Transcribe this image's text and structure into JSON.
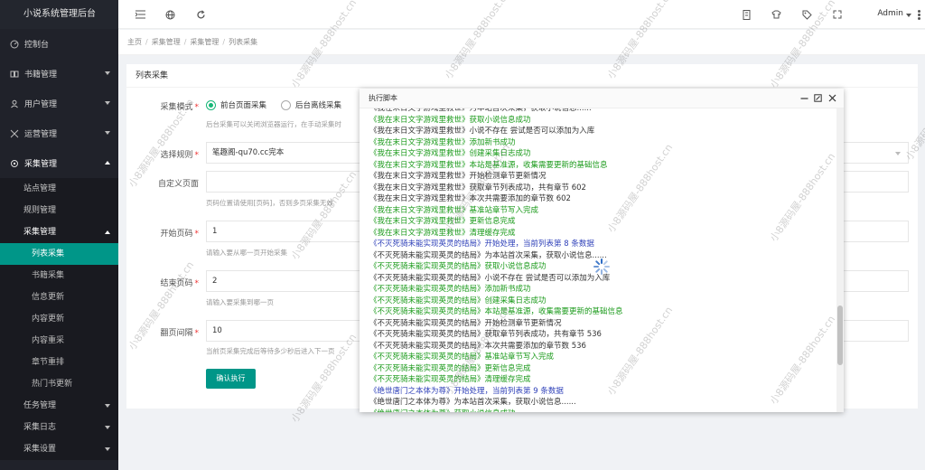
{
  "app": {
    "title": "小说系统管理后台"
  },
  "sidebar": {
    "items": [
      {
        "label": "控制台",
        "icon": "dashboard-icon"
      },
      {
        "label": "书籍管理",
        "icon": "book-icon"
      },
      {
        "label": "用户管理",
        "icon": "user-icon"
      },
      {
        "label": "运营管理",
        "icon": "operation-icon"
      },
      {
        "label": "采集管理",
        "icon": "collect-icon"
      }
    ],
    "collect_sub": [
      "站点管理",
      "规则管理",
      "采集管理"
    ],
    "collect_sub_sub": [
      "列表采集",
      "书籍采集",
      "信息更新",
      "内容更新",
      "内容重采",
      "章节重排",
      "热门书更新"
    ],
    "bottom_items": [
      "任务管理",
      "采集日志",
      "采集设置"
    ]
  },
  "header": {
    "admin": "Admin"
  },
  "breadcrumb": [
    "主页",
    "采集管理",
    "采集管理",
    "列表采集"
  ],
  "card": {
    "title": "列表采集",
    "mode_label": "采集模式",
    "mode_options": [
      "前台页面采集",
      "后台离线采集"
    ],
    "mode_tip": "后台采集可以关闭浏览器运行，在手动采集时",
    "rule_label": "选择规则",
    "rule_value": "笔趣阁-qu70.cc完本",
    "custom_label": "自定义页面",
    "custom_tip": "页码位置请使用[页码]，否则多页采集无效",
    "start_label": "开始页码",
    "start_value": "1",
    "start_tip": "请输入要从哪一页开始采集",
    "end_label": "结束页码",
    "end_value": "2",
    "end_tip": "请输入要采集到哪一页",
    "interval_label": "翻页间隔",
    "interval_value": "10",
    "interval_tip": "当前页采集完成后等待多少秒后进入下一页",
    "submit": "确认执行"
  },
  "modal": {
    "title": "执行脚本",
    "log": [
      {
        "t": "《我在末日文字游戏里救世》为本站首次采集，获取小说信息......",
        "c": "dark"
      },
      {
        "t": "《我在末日文字游戏里救世》获取小说信息成功",
        "c": "green"
      },
      {
        "t": "《我在末日文字游戏里救世》小说不存在 尝试是否可以添加为入库",
        "c": "dark"
      },
      {
        "t": "《我在末日文字游戏里救世》添加新书成功",
        "c": "green"
      },
      {
        "t": "《我在末日文字游戏里救世》创建采集日志成功",
        "c": "green"
      },
      {
        "t": "《我在末日文字游戏里救世》本站是基准源，收集需要更新的基础信息",
        "c": "green"
      },
      {
        "t": "《我在末日文字游戏里救世》开始检测章节更新情况",
        "c": "dark"
      },
      {
        "t": "《我在末日文字游戏里救世》获取章节列表成功，共有章节 602",
        "c": "dark"
      },
      {
        "t": "《我在末日文字游戏里救世》本次共需要添加的章节数 602",
        "c": "dark"
      },
      {
        "t": "《我在末日文字游戏里救世》基准站章节写入完成",
        "c": "green"
      },
      {
        "t": "《我在末日文字游戏里救世》更新信息完成",
        "c": "green"
      },
      {
        "t": "《我在末日文字游戏里救世》清理缓存完成",
        "c": "green"
      },
      {
        "t": "《不灭死骑未能实现英灵的结局》开始处理，当前列表第 8 条数据",
        "c": "blue"
      },
      {
        "t": "《不灭死骑未能实现英灵的结局》为本站首次采集，获取小说信息......",
        "c": "dark"
      },
      {
        "t": "《不灭死骑未能实现英灵的结局》获取小说信息成功",
        "c": "green"
      },
      {
        "t": "《不灭死骑未能实现英灵的结局》小说不存在 尝试是否可以添加为入库",
        "c": "dark"
      },
      {
        "t": "《不灭死骑未能实现英灵的结局》添加新书成功",
        "c": "green"
      },
      {
        "t": "《不灭死骑未能实现英灵的结局》创建采集日志成功",
        "c": "green"
      },
      {
        "t": "《不灭死骑未能实现英灵的结局》本站是基准源，收集需要更新的基础信息",
        "c": "green"
      },
      {
        "t": "《不灭死骑未能实现英灵的结局》开始检测章节更新情况",
        "c": "dark"
      },
      {
        "t": "《不灭死骑未能实现英灵的结局》获取章节列表成功，共有章节 536",
        "c": "dark"
      },
      {
        "t": "《不灭死骑未能实现英灵的结局》本次共需要添加的章节数 536",
        "c": "dark"
      },
      {
        "t": "《不灭死骑未能实现英灵的结局》基准站章节写入完成",
        "c": "green"
      },
      {
        "t": "《不灭死骑未能实现英灵的结局》更新信息完成",
        "c": "green"
      },
      {
        "t": "《不灭死骑未能实现英灵的结局》清理缓存完成",
        "c": "green"
      },
      {
        "t": "《绝世唐门之本体为尊》开始处理，当前列表第 9 条数据",
        "c": "blue"
      },
      {
        "t": "《绝世唐门之本体为尊》为本站首次采集，获取小说信息......",
        "c": "dark"
      },
      {
        "t": "《绝世唐门之本体为尊》获取小说信息成功",
        "c": "green"
      }
    ]
  },
  "watermark": "小8源码屋-888host.cn"
}
